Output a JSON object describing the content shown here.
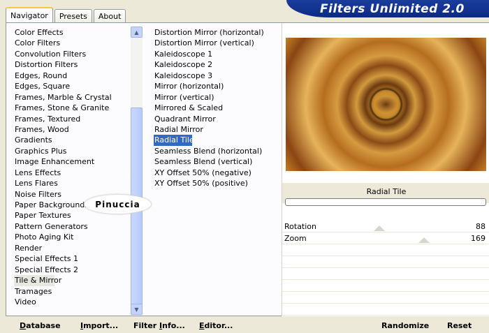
{
  "tabs": [
    "Navigator",
    "Presets",
    "About"
  ],
  "banner": "Filters Unlimited 2.0",
  "categories": [
    "Color Effects",
    "Color Filters",
    "Convolution Filters",
    "Distortion Filters",
    "Edges, Round",
    "Edges, Square",
    "Frames, Marble & Crystal",
    "Frames, Stone & Granite",
    "Frames, Textured",
    "Frames, Wood",
    "Gradients",
    "Graphics Plus",
    "Image Enhancement",
    "Lens Effects",
    "Lens Flares",
    "Noise Filters",
    "Paper Backgrounds",
    "Paper Textures",
    "Pattern Generators",
    "Photo Aging Kit",
    "Render",
    "Special Effects 1",
    "Special Effects 2",
    "Tile & Mirror",
    "Tramages",
    "Video"
  ],
  "selected_category": "Tile & Mirror",
  "filters": [
    "Distortion Mirror (horizontal)",
    "Distortion Mirror (vertical)",
    "Kaleidoscope 1",
    "Kaleidoscope 2",
    "Kaleidoscope 3",
    "Mirror (horizontal)",
    "Mirror (vertical)",
    "Mirrored & Scaled",
    "Quadrant Mirror",
    "Radial Mirror",
    "Radial Tile",
    "Seamless Blend (horizontal)",
    "Seamless Blend (vertical)",
    "XY Offset 50% (negative)",
    "XY Offset 50% (positive)"
  ],
  "selected_filter": "Radial Tile",
  "preview_caption": "Radial Tile",
  "sliders": [
    {
      "label": "Rotation",
      "value": "88",
      "level": 0.345
    },
    {
      "label": "Zoom",
      "value": "169",
      "level": 0.663
    }
  ],
  "buttons": {
    "database": "Database",
    "import": "Import...",
    "filter_info": "Filter Info...",
    "editor": "Editor...",
    "randomize": "Randomize",
    "reset": "Reset"
  },
  "watermark": "Pinuccia",
  "colors": {
    "selection": "#316ac5",
    "banner": "#0b2a84",
    "tab_accent": "#ffc83c"
  }
}
